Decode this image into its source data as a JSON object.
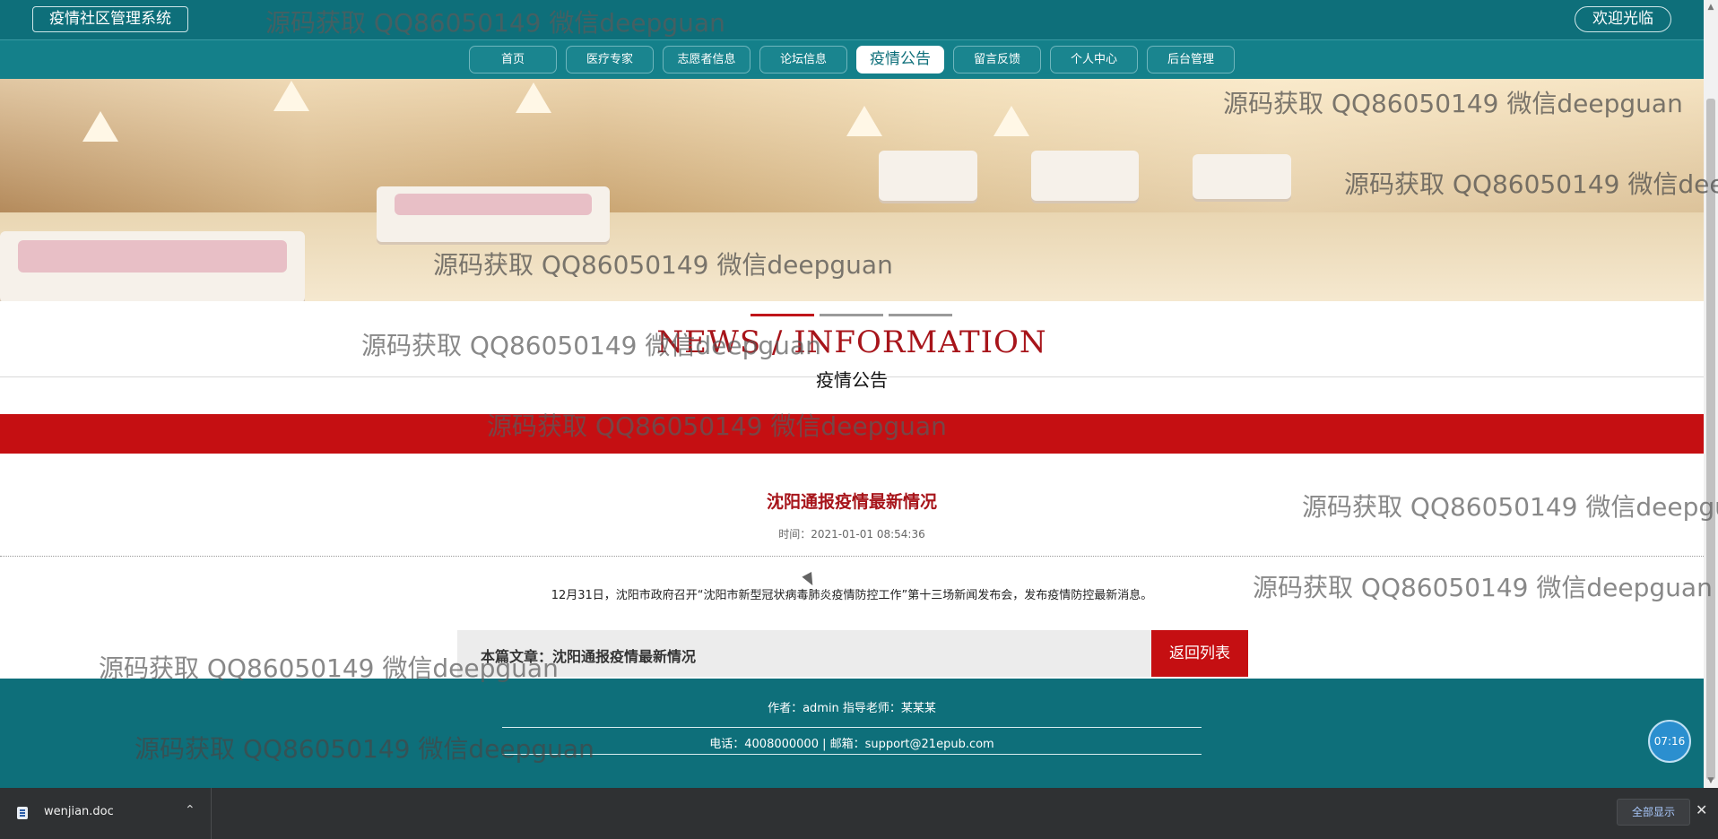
{
  "header": {
    "site_title": "疫情社区管理系统",
    "welcome": "欢迎光临"
  },
  "nav": {
    "items": [
      {
        "label": "首页"
      },
      {
        "label": "医疗专家"
      },
      {
        "label": "志愿者信息"
      },
      {
        "label": "论坛信息"
      },
      {
        "label": "疫情公告",
        "active": true
      },
      {
        "label": "留言反馈"
      },
      {
        "label": "个人中心"
      },
      {
        "label": "后台管理"
      }
    ]
  },
  "section": {
    "title_en": "NEWS / INFORMATION",
    "title_cn": "疫情公告"
  },
  "article": {
    "title": "沈阳通报疫情最新情况",
    "time": "时间：2021-01-01 08:54:36",
    "body": "12月31日，沈阳市政府召开“沈阳市新型冠状病毒肺炎疫情防控工作”第十三场新闻发布会，发布疫情防控最新消息。",
    "this_article": "本篇文章：沈阳通报疫情最新情况",
    "back_label": "返回列表"
  },
  "footer": {
    "line1": "作者：admin 指导老师：某某某",
    "line2": "电话：4008000000 | 邮箱：support@21epub.com"
  },
  "clock": "07:16",
  "watermark": "源码获取 QQ86050149 微信deepguan",
  "download_bar": {
    "file_name": "wenjian.doc",
    "show_all": "全部显示"
  },
  "colors": {
    "primary": "#0e6f7a",
    "accent_red": "#c50f12",
    "title_red": "#a7141a"
  }
}
